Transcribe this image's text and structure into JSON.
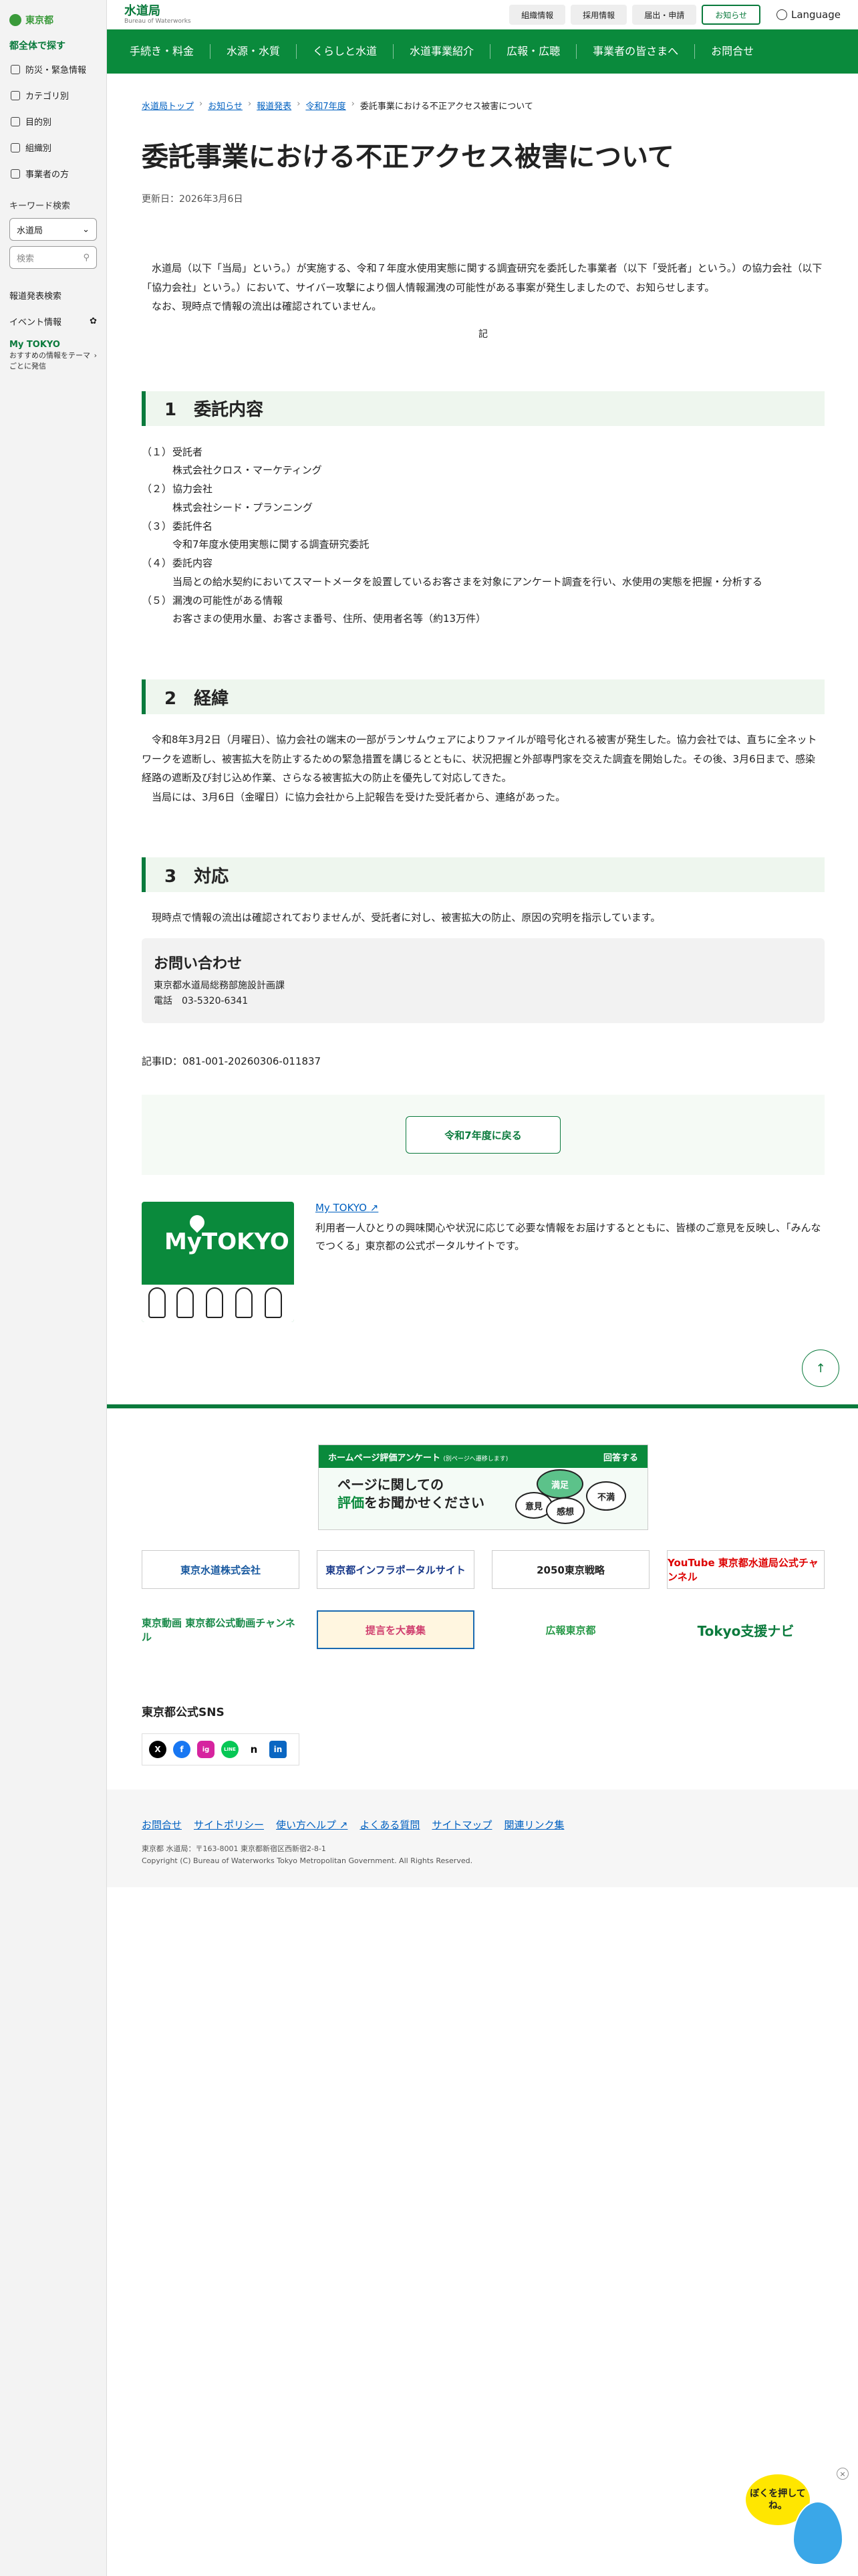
{
  "sidebar": {
    "logo": "東京都",
    "section_title": "都全体で探す",
    "items": [
      {
        "label": "防災・緊急情報"
      },
      {
        "label": "カテゴリ別"
      },
      {
        "label": "目的別"
      },
      {
        "label": "組織別"
      },
      {
        "label": "事業者の方"
      }
    ],
    "keyword_label": "キーワード検索",
    "keyword_select": "水道局",
    "search_placeholder": "検索",
    "press_search": "報道発表検索",
    "event_info": "イベント情報",
    "mytokyo_title": "My TOKYO",
    "mytokyo_desc": "おすすめの情報をテーマごとに発信"
  },
  "header": {
    "site_title": "水道局",
    "site_subtitle": "Bureau of Waterworks",
    "top_links": [
      "組織情報",
      "採用情報",
      "届出・申請",
      "お知らせ"
    ],
    "language": "Language",
    "nav": [
      "手続き・料金",
      "水源・水質",
      "くらしと水道",
      "水道事業紹介",
      "広報・広聴",
      "事業者の皆さまへ",
      "お問合せ"
    ]
  },
  "breadcrumb": [
    "水道局トップ",
    "お知らせ",
    "報道発表",
    "令和7年度",
    "委託事業における不正アクセス被害について"
  ],
  "article": {
    "title": "委託事業における不正アクセス被害について",
    "updated": "更新日：2026年3月6日",
    "lead_1": "水道局（以下「当局」という。）が実施する、令和７年度水使用実態に関する調査研究を委託した事業者（以下「受託者」という。）の協力会社（以下「協力会社」という。）において、サイバー攻撃により個人情報漏洩の可能性がある事案が発生しましたので、お知らせします。",
    "lead_2": "なお、現時点で情報の流出は確認されていません。",
    "ki": "記",
    "sec1_title": "1　委託内容",
    "sec1_items": [
      {
        "num": "（１）",
        "label": "受託者",
        "value": "株式会社クロス・マーケティング"
      },
      {
        "num": "（２）",
        "label": "協力会社",
        "value": "株式会社シード・プランニング"
      },
      {
        "num": "（３）",
        "label": "委託件名",
        "value": "令和7年度水使用実態に関する調査研究委託"
      },
      {
        "num": "（４）",
        "label": "委託内容",
        "value": "当局との給水契約においてスマートメータを設置しているお客さまを対象にアンケート調査を行い、水使用の実態を把握・分析する"
      },
      {
        "num": "（５）",
        "label": "漏洩の可能性がある情報",
        "value": "お客さまの使用水量、お客さま番号、住所、使用者名等（約13万件）"
      }
    ],
    "sec2_title": "2　経緯",
    "sec2_p1": "令和8年3月2日（月曜日）、協力会社の端末の一部がランサムウェアによりファイルが暗号化される被害が発生した。協力会社では、直ちに全ネットワークを遮断し、被害拡大を防止するための緊急措置を講じるとともに、状況把握と外部専門家を交えた調査を開始した。その後、3月6日まで、感染経路の遮断及び封じ込め作業、さらなる被害拡大の防止を優先して対応してきた。",
    "sec2_p2": "当局には、3月6日（金曜日）に協力会社から上記報告を受けた受託者から、連絡があった。",
    "sec3_title": "3　対応",
    "sec3_p1": "現時点で情報の流出は確認されておりませんが、受託者に対し、被害拡大の防止、原因の究明を指示しています。",
    "contact_title": "お問い合わせ",
    "contact_org": "東京都水道局総務部施設計画課",
    "contact_tel": "電話　03-5320-6341",
    "article_id": "記事ID：081-001-20260306-011837",
    "back_button": "令和7年度に戻る",
    "promo_link": "My TOKYO",
    "promo_text": "利用者一人ひとりの興味関心や状況に応じて必要な情報をお届けするとともに、皆様のご意見を反映し、「みんなでつくる」東京都の公式ポータルサイトです。",
    "promo_brand": "MyTOKYO"
  },
  "footer": {
    "survey_bar": "ホームページ評価アンケート",
    "survey_bar_note": "(別ページへ遷移します)",
    "survey_answer": "回答する",
    "survey_text_1": "ページに関しての",
    "survey_text_2a": "評価",
    "survey_text_2b": "をお聞かせください",
    "survey_bubbles": [
      "満足",
      "不満",
      "意見",
      "感想"
    ],
    "banners": [
      "東京水道株式会社",
      "東京都インフラポータルサイト",
      "2050東京戦略",
      "YouTube 東京都水道局公式チャンネル",
      "東京動画 東京都公式動画チャンネル",
      "提言を大募集",
      "広報東京都",
      "Tokyo支援ナビ"
    ],
    "sns_title": "東京都公式SNS",
    "sns": [
      "X",
      "f",
      "ig",
      "LINE",
      "n",
      "in"
    ],
    "links": [
      "お問合せ",
      "サイトポリシー",
      "使い方ヘルプ",
      "よくある質問",
      "サイトマップ",
      "関連リンク集"
    ],
    "address": "東京都 水道局：〒163-8001 東京都新宿区西新宿2-8-1",
    "copyright": "Copyright (C) Bureau of Waterworks Tokyo Metropolitan Government. All Rights Reserved."
  },
  "mascot": {
    "speech": "ぼくを押してね。"
  },
  "colors": {
    "brand_green": "#0a8a3c",
    "link_blue": "#0060c0"
  }
}
